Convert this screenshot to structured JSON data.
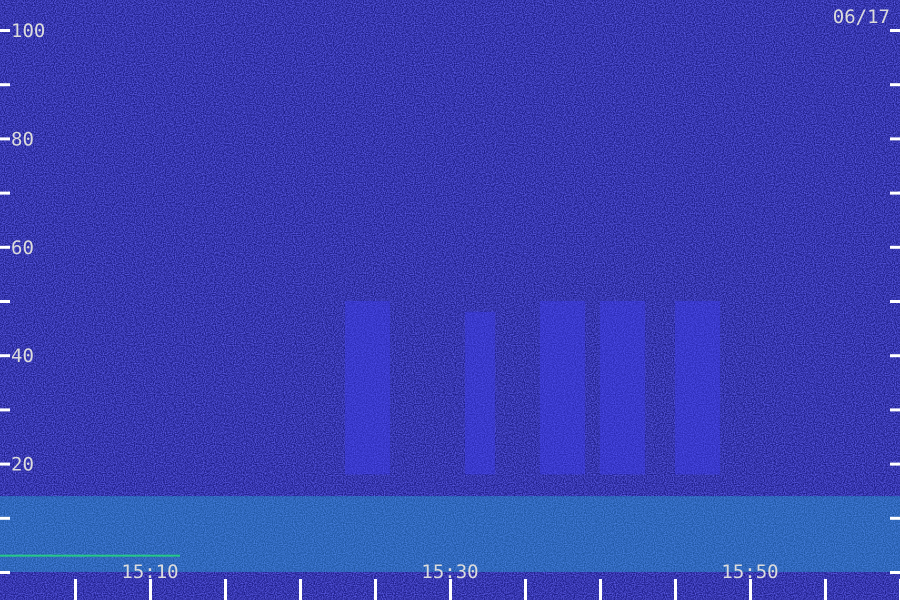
{
  "date_label": "06/17",
  "colors": {
    "background": "#0a0a2e",
    "noise": "#2a2ad0",
    "noise_bright": "#3f3ff0",
    "signal": "#25c7d8",
    "signal_bright": "#22e07a",
    "tick": "#ffffff",
    "text": "#dcdcdc"
  },
  "chart_data": {
    "type": "heatmap",
    "title": "",
    "xlabel": "",
    "ylabel": "",
    "x_tick_labels": [
      "15:10",
      "15:30",
      "15:50"
    ],
    "x_major_times": [
      "15:05",
      "15:10",
      "15:15",
      "15:20",
      "15:25",
      "15:30",
      "15:35",
      "15:40",
      "15:45",
      "15:50",
      "15:55",
      "16:00"
    ],
    "x_range": [
      "15:00",
      "16:00"
    ],
    "ylim": [
      0,
      100
    ],
    "y_ticks": [
      0,
      10,
      20,
      30,
      40,
      50,
      60,
      70,
      80,
      90,
      100
    ],
    "y_tick_labels": [
      "20",
      "40",
      "60",
      "80",
      "100"
    ],
    "bursts": [
      {
        "start": "15:23",
        "end": "15:26",
        "freq_low": 18,
        "freq_high": 50
      },
      {
        "start": "15:31",
        "end": "15:33",
        "freq_low": 18,
        "freq_high": 48
      },
      {
        "start": "15:36",
        "end": "15:39",
        "freq_low": 18,
        "freq_high": 50
      },
      {
        "start": "15:40",
        "end": "15:43",
        "freq_low": 18,
        "freq_high": 50
      },
      {
        "start": "15:45",
        "end": "15:48",
        "freq_low": 18,
        "freq_high": 50
      }
    ],
    "low_band_hz": [
      0,
      14
    ],
    "grid": false,
    "legend": "none"
  }
}
